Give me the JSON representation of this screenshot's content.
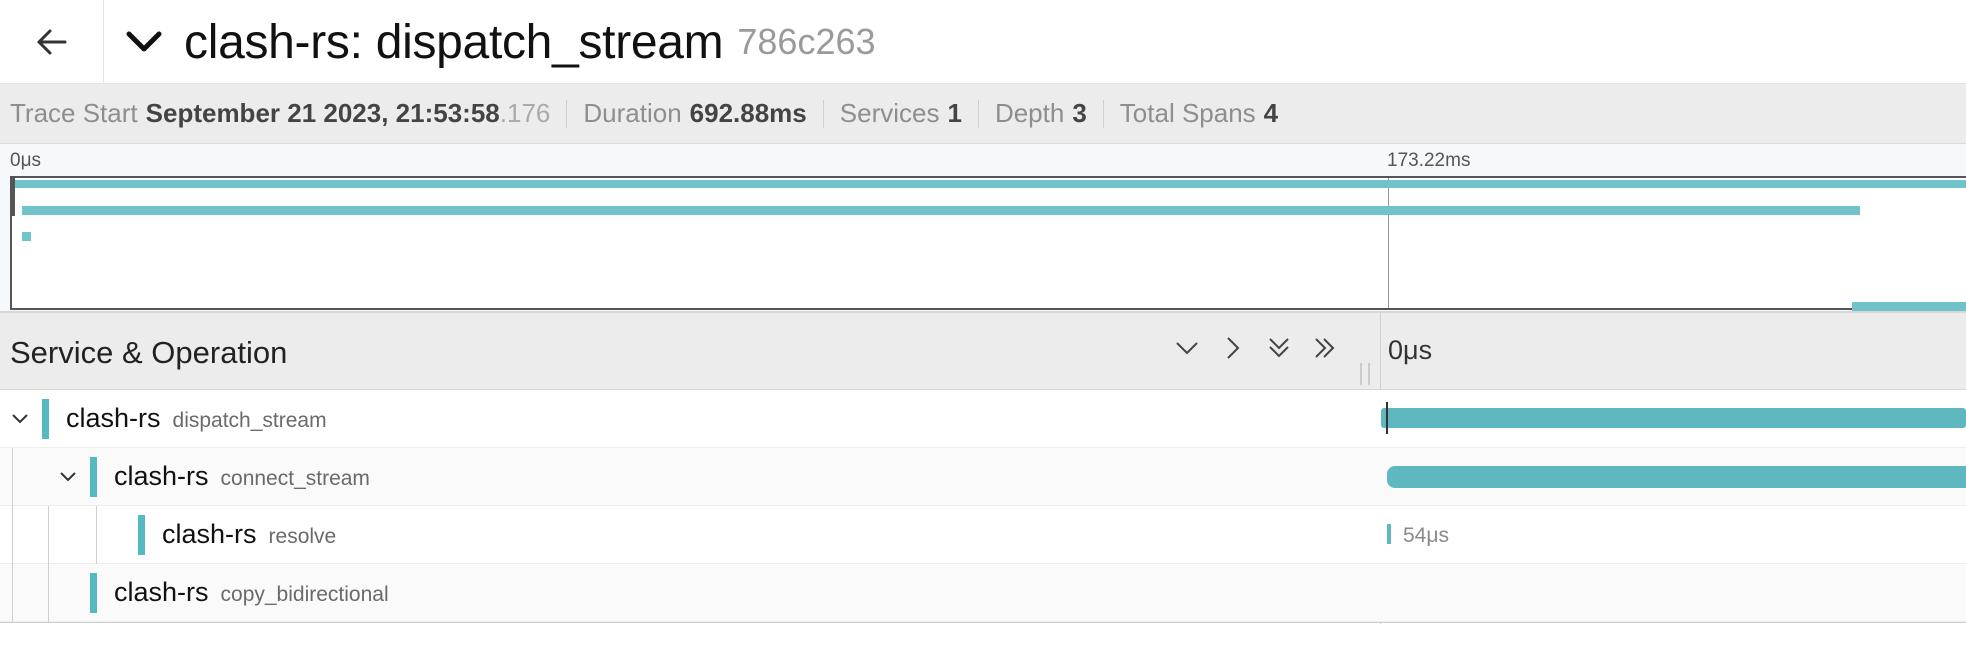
{
  "header": {
    "title": "clash-rs: dispatch_stream",
    "trace_id": "786c263"
  },
  "meta": {
    "trace_start_label": "Trace Start",
    "trace_start_value": "September 21 2023, 21:53:58",
    "trace_start_ms": ".176",
    "duration_label": "Duration",
    "duration_value": "692.88ms",
    "services_label": "Services",
    "services_value": "1",
    "depth_label": "Depth",
    "depth_value": "3",
    "total_spans_label": "Total Spans",
    "total_spans_value": "4"
  },
  "minimap": {
    "tick_0": "0μs",
    "tick_1": "173.22ms"
  },
  "table": {
    "column_title": "Service & Operation",
    "time_header": "0μs"
  },
  "spans": [
    {
      "service": "clash-rs",
      "operation": "dispatch_stream",
      "depth": 0,
      "expanded": true
    },
    {
      "service": "clash-rs",
      "operation": "connect_stream",
      "depth": 1,
      "expanded": true
    },
    {
      "service": "clash-rs",
      "operation": "resolve",
      "depth": 2,
      "duration": "54μs"
    },
    {
      "service": "clash-rs",
      "operation": "copy_bidirectional",
      "depth": 1
    }
  ],
  "colors": {
    "span": "#5fb8bf",
    "service_bar": "#54b9c1"
  }
}
